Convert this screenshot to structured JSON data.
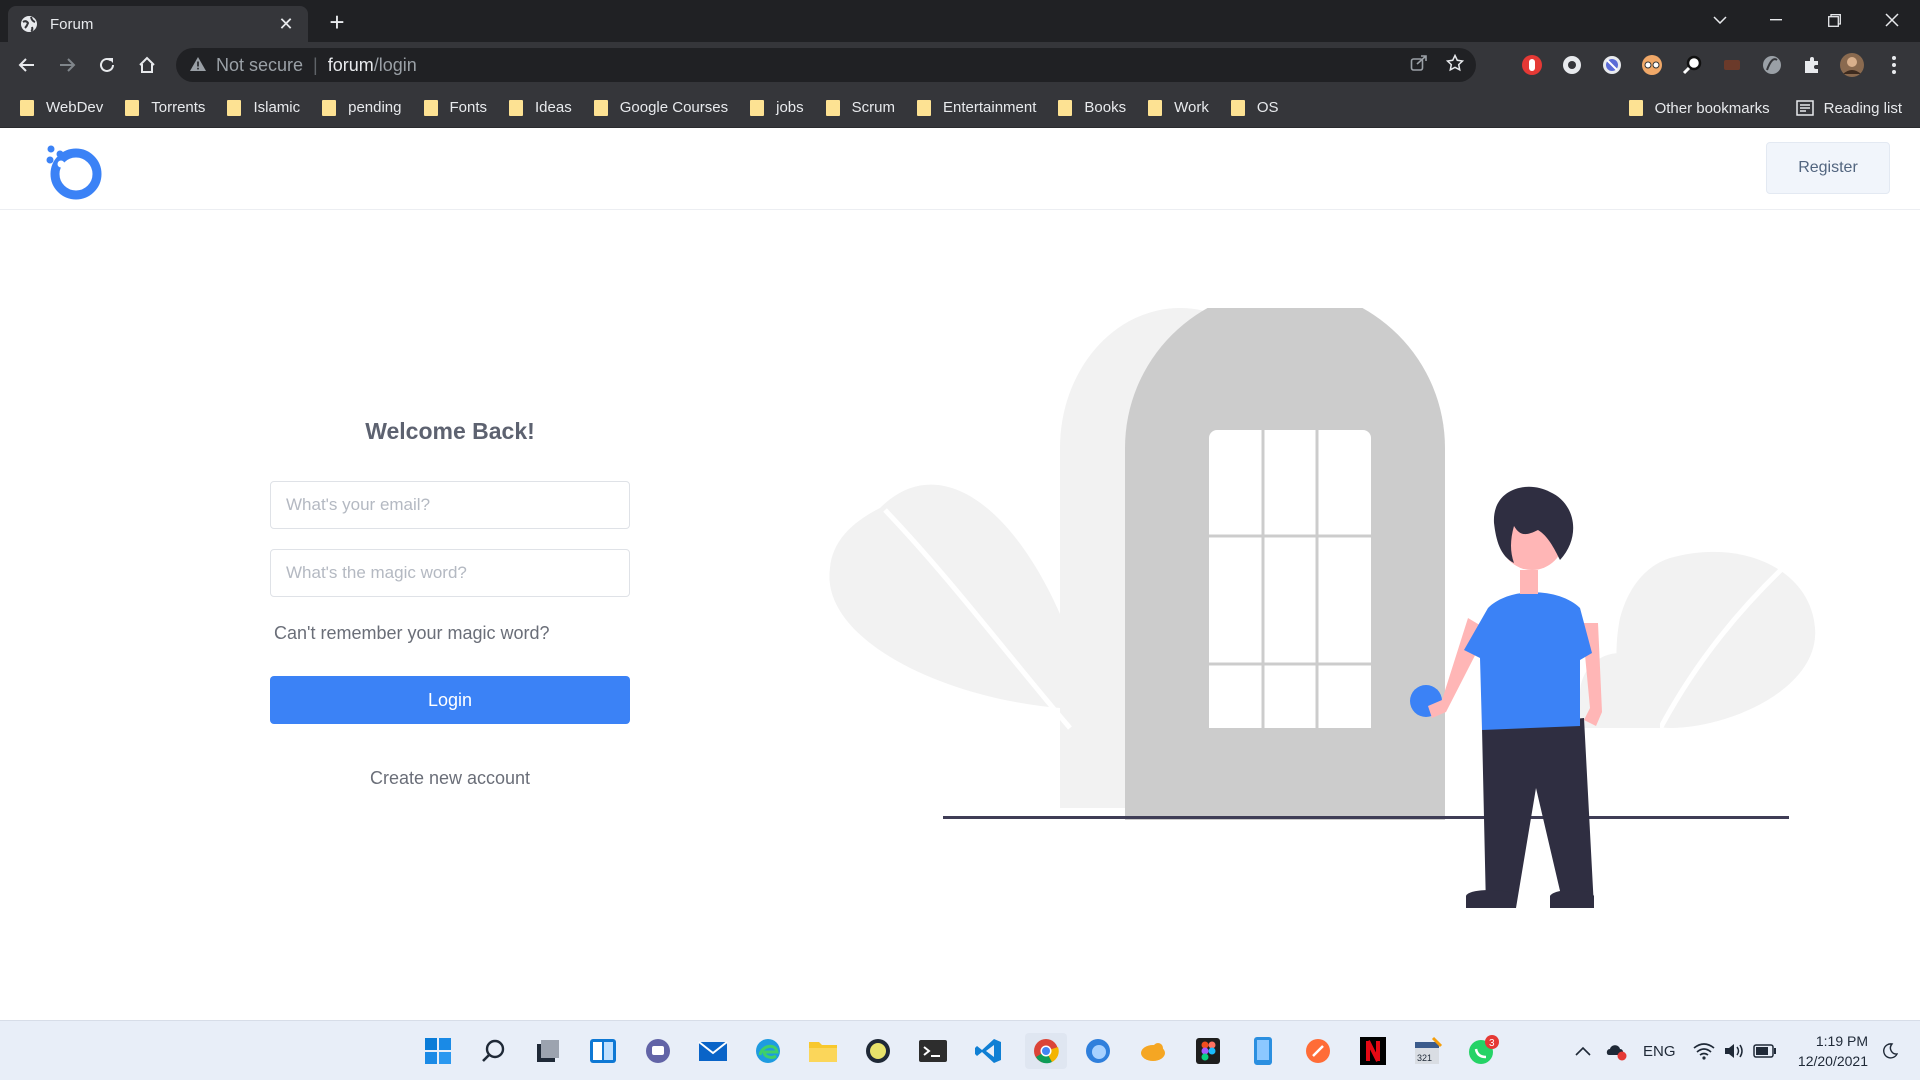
{
  "browser": {
    "tab_title": "Forum",
    "new_tab": "+",
    "security_label": "Not secure",
    "url_host": "forum",
    "url_path": "/login",
    "bookmarks": [
      "WebDev",
      "Torrents",
      "Islamic",
      "pending",
      "Fonts",
      "Ideas",
      "Google Courses",
      "jobs",
      "Scrum",
      "Entertainment",
      "Books",
      "Work",
      "OS"
    ],
    "other_bookmarks": "Other bookmarks",
    "reading_list": "Reading list"
  },
  "header": {
    "register_label": "Register"
  },
  "login": {
    "title": "Welcome Back!",
    "email_placeholder": "What's your email?",
    "password_placeholder": "What's the magic word?",
    "forgot_label": "Can't remember your magic word?",
    "login_label": "Login",
    "create_label": "Create new account"
  },
  "colors": {
    "accent": "#3b82f6",
    "chrome_dark": "#202124",
    "chrome_mid": "#35363a",
    "shirt": "#3b82f6",
    "pants": "#2f2e41",
    "skin": "#ffb6b6",
    "door": "#cccccc"
  },
  "taskbar": {
    "lang": "ENG",
    "time": "1:19 PM",
    "date": "12/20/2021",
    "whatsapp_badge": "3",
    "calendar_label": "321"
  }
}
